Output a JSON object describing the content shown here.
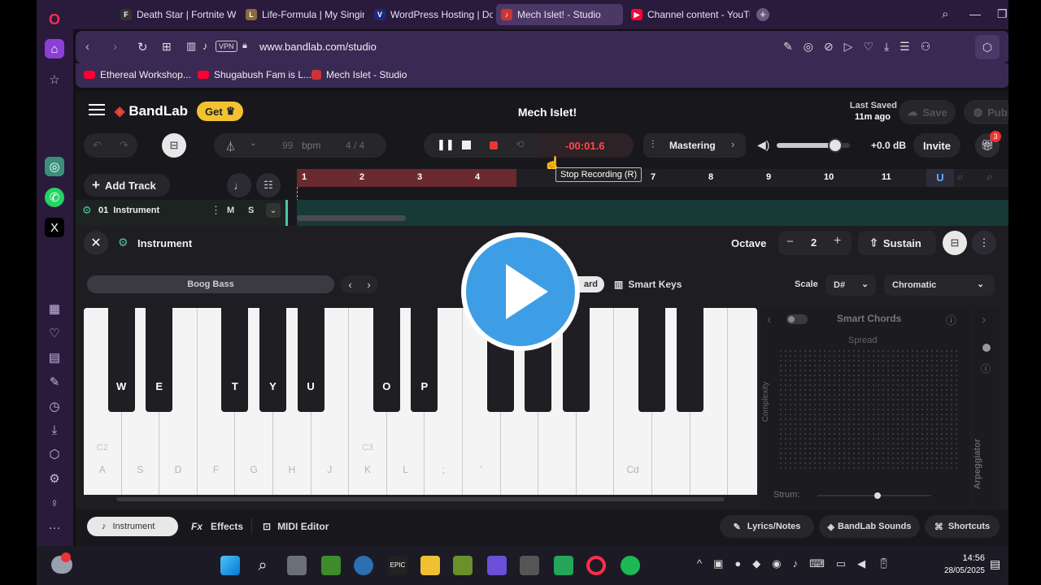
{
  "tabs": [
    {
      "label": "Death Star | Fortnite Wiki",
      "fav": "F",
      "color": "#333"
    },
    {
      "label": "Life-Formula | My Singing",
      "fav": "L",
      "color": "#8a6a3b"
    },
    {
      "label": "WordPress Hosting | Dom",
      "fav": "V",
      "color": "#1b2a7a"
    },
    {
      "label": "Mech Islet! - Studio",
      "fav": "♪",
      "color": "#c33"
    },
    {
      "label": "Channel content - YouTub",
      "fav": "▶",
      "color": "#f03"
    }
  ],
  "address": {
    "url": "www.bandlab.com/studio",
    "vpn": "VPN"
  },
  "bookmarks": [
    "Ethereal Workshop...",
    "Shugabush Fam is L...",
    "Mech Islet - Studio"
  ],
  "studio": {
    "brand": "BandLab",
    "get_label": "Get",
    "project_title": "Mech Islet!",
    "last_saved_label": "Last Saved",
    "last_saved_time": "11m ago",
    "save_label": "Save",
    "publish_label": "Publish",
    "bpm_value": "99",
    "bpm_label": "bpm",
    "time_sig": "4 / 4",
    "time_display": "-00:01.6",
    "mastering_label": "Mastering",
    "volume_db": "+0.0 dB",
    "volume_level": 0.8,
    "invite_label": "Invite",
    "notification_count": "3",
    "add_track_label": "Add Track",
    "tooltip": "Stop Recording (R)",
    "ruler": [
      "1",
      "2",
      "3",
      "4",
      "7",
      "8",
      "9",
      "10",
      "11"
    ],
    "track": {
      "name": "01  Instrument",
      "m": "M",
      "s": "S"
    }
  },
  "instrument": {
    "title": "Instrument",
    "octave_label": "Octave",
    "octave_value": "2",
    "sustain_label": "Sustain",
    "preset": "Boog Bass",
    "tab_keyboard_fragment": "ard",
    "smart_keys_label": "Smart Keys",
    "scale_label": "Scale",
    "scale_key": "D#",
    "scale_type": "Chromatic",
    "white_keys": [
      "A",
      "S",
      "D",
      "F",
      "G",
      "H",
      "J",
      "K",
      "L",
      ";",
      "'",
      "",
      "",
      "",
      "Cd",
      "",
      "",
      ""
    ],
    "white_octave_labels": {
      "0": "C2",
      "7": "C3"
    },
    "black_keys": [
      {
        "label": "W",
        "after": 1
      },
      {
        "label": "E",
        "after": 2
      },
      {
        "label": "T",
        "after": 4
      },
      {
        "label": "Y",
        "after": 5
      },
      {
        "label": "U",
        "after": 6
      },
      {
        "label": "O",
        "after": 8
      },
      {
        "label": "P",
        "after": 9
      },
      {
        "label": "",
        "after": 11
      },
      {
        "label": "",
        "after": 12
      },
      {
        "label": "",
        "after": 13
      },
      {
        "label": "",
        "after": 15
      },
      {
        "label": "",
        "after": 16
      }
    ],
    "smart_chords_label": "Smart Chords",
    "spread_label": "Spread",
    "complexity_label": "Complexity",
    "strum_label": "Strum:",
    "arpeggiator_label": "Arpeggiator"
  },
  "bottom_tabs": {
    "instrument": "Instrument",
    "effects_prefix": "Fx",
    "effects": "Effects",
    "midi": "MIDI Editor",
    "lyrics": "Lyrics/Notes",
    "sounds": "BandLab Sounds",
    "shortcuts": "Shortcuts"
  },
  "taskbar": {
    "time": "14:56",
    "date": "28/05/2025"
  }
}
